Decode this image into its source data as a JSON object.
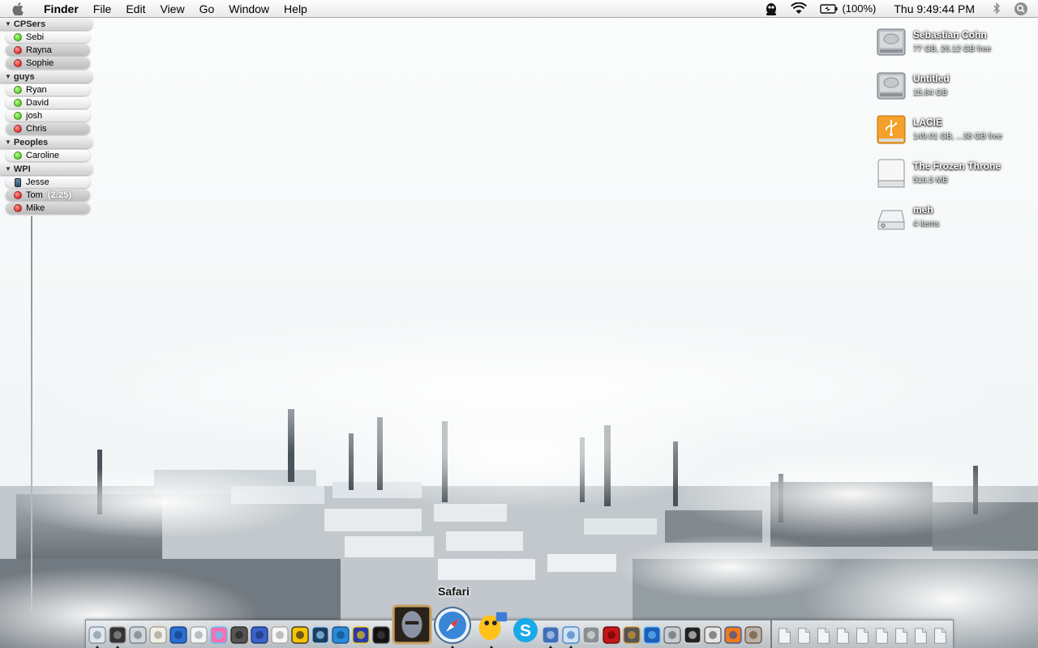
{
  "menubar": {
    "app_name": "Finder",
    "menus": [
      "File",
      "Edit",
      "View",
      "Go",
      "Window",
      "Help"
    ],
    "battery": "(100%)",
    "clock": "Thu 9:49:44 PM"
  },
  "buddylist": {
    "groups": [
      {
        "name": "CPSers",
        "buddies": [
          {
            "name": "Sebi",
            "status": "available"
          },
          {
            "name": "Rayna",
            "status": "away"
          },
          {
            "name": "Sophie",
            "status": "away"
          }
        ]
      },
      {
        "name": "guys",
        "buddies": [
          {
            "name": "Ryan",
            "status": "available"
          },
          {
            "name": "David",
            "status": "available"
          },
          {
            "name": "josh",
            "status": "available"
          },
          {
            "name": "Chris",
            "status": "away"
          }
        ]
      },
      {
        "name": "Peoples",
        "buddies": [
          {
            "name": "Caroline",
            "status": "available"
          }
        ]
      },
      {
        "name": "WPI",
        "buddies": [
          {
            "name": "Jesse",
            "status": "mobile"
          },
          {
            "name": "Tom",
            "status": "away",
            "idle": "(2:25)"
          },
          {
            "name": "Mike",
            "status": "away"
          }
        ]
      }
    ]
  },
  "desktop": {
    "volumes": [
      {
        "name": "Sebastian Cohn",
        "info": "77 GB, 26.12 GB free",
        "icon": "hard-drive-icon"
      },
      {
        "name": "Untitled",
        "info": "15.84 GB",
        "icon": "hard-drive-icon"
      },
      {
        "name": "LACIE",
        "info": "149.01 GB, ...38 GB free",
        "icon": "usb-drive-icon"
      },
      {
        "name": "The Frozen Throne",
        "info": "516.5 MB",
        "icon": "disk-image-icon"
      },
      {
        "name": "meh",
        "info": "4 items",
        "icon": "server-volume-icon"
      }
    ]
  },
  "dock": {
    "hover_label": "Safari",
    "apps": [
      "finder-icon",
      "dashboard-icon",
      "mail-icon",
      "textedit-icon",
      "word-icon",
      "pages-icon",
      "color-picker-icon",
      "preview-icon",
      "network-icon",
      "notes-icon",
      "mamp-icon",
      "dreamweaver-icon",
      "mamp-pro-icon",
      "app-icon",
      "game-icon",
      "warcraft-icon",
      "safari-icon",
      "adium-icon",
      "skype-icon",
      "script-editor-icon",
      "itunes-icon",
      "iphoto-icon",
      "photo-booth-icon",
      "image-viewer-icon",
      "google-earth-icon",
      "sync-icon",
      "terminal-icon",
      "quill-icon",
      "firefox-icon",
      "coffee-icon"
    ],
    "docs": [
      "document-icon",
      "document-icon",
      "document-icon",
      "document-icon",
      "document-icon",
      "document-icon",
      "document-icon",
      "document-icon",
      "document-icon"
    ]
  },
  "colors": {
    "available": "#2fb400",
    "away": "#d30000",
    "menubar": "#ececec"
  }
}
